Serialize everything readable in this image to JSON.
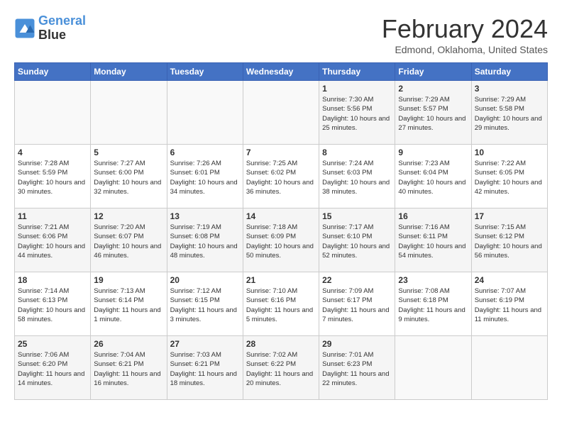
{
  "logo": {
    "line1": "General",
    "line2": "Blue"
  },
  "title": "February 2024",
  "subtitle": "Edmond, Oklahoma, United States",
  "days_of_week": [
    "Sunday",
    "Monday",
    "Tuesday",
    "Wednesday",
    "Thursday",
    "Friday",
    "Saturday"
  ],
  "weeks": [
    [
      {
        "day": "",
        "info": ""
      },
      {
        "day": "",
        "info": ""
      },
      {
        "day": "",
        "info": ""
      },
      {
        "day": "",
        "info": ""
      },
      {
        "day": "1",
        "info": "Sunrise: 7:30 AM\nSunset: 5:56 PM\nDaylight: 10 hours and 25 minutes."
      },
      {
        "day": "2",
        "info": "Sunrise: 7:29 AM\nSunset: 5:57 PM\nDaylight: 10 hours and 27 minutes."
      },
      {
        "day": "3",
        "info": "Sunrise: 7:29 AM\nSunset: 5:58 PM\nDaylight: 10 hours and 29 minutes."
      }
    ],
    [
      {
        "day": "4",
        "info": "Sunrise: 7:28 AM\nSunset: 5:59 PM\nDaylight: 10 hours and 30 minutes."
      },
      {
        "day": "5",
        "info": "Sunrise: 7:27 AM\nSunset: 6:00 PM\nDaylight: 10 hours and 32 minutes."
      },
      {
        "day": "6",
        "info": "Sunrise: 7:26 AM\nSunset: 6:01 PM\nDaylight: 10 hours and 34 minutes."
      },
      {
        "day": "7",
        "info": "Sunrise: 7:25 AM\nSunset: 6:02 PM\nDaylight: 10 hours and 36 minutes."
      },
      {
        "day": "8",
        "info": "Sunrise: 7:24 AM\nSunset: 6:03 PM\nDaylight: 10 hours and 38 minutes."
      },
      {
        "day": "9",
        "info": "Sunrise: 7:23 AM\nSunset: 6:04 PM\nDaylight: 10 hours and 40 minutes."
      },
      {
        "day": "10",
        "info": "Sunrise: 7:22 AM\nSunset: 6:05 PM\nDaylight: 10 hours and 42 minutes."
      }
    ],
    [
      {
        "day": "11",
        "info": "Sunrise: 7:21 AM\nSunset: 6:06 PM\nDaylight: 10 hours and 44 minutes."
      },
      {
        "day": "12",
        "info": "Sunrise: 7:20 AM\nSunset: 6:07 PM\nDaylight: 10 hours and 46 minutes."
      },
      {
        "day": "13",
        "info": "Sunrise: 7:19 AM\nSunset: 6:08 PM\nDaylight: 10 hours and 48 minutes."
      },
      {
        "day": "14",
        "info": "Sunrise: 7:18 AM\nSunset: 6:09 PM\nDaylight: 10 hours and 50 minutes."
      },
      {
        "day": "15",
        "info": "Sunrise: 7:17 AM\nSunset: 6:10 PM\nDaylight: 10 hours and 52 minutes."
      },
      {
        "day": "16",
        "info": "Sunrise: 7:16 AM\nSunset: 6:11 PM\nDaylight: 10 hours and 54 minutes."
      },
      {
        "day": "17",
        "info": "Sunrise: 7:15 AM\nSunset: 6:12 PM\nDaylight: 10 hours and 56 minutes."
      }
    ],
    [
      {
        "day": "18",
        "info": "Sunrise: 7:14 AM\nSunset: 6:13 PM\nDaylight: 10 hours and 58 minutes."
      },
      {
        "day": "19",
        "info": "Sunrise: 7:13 AM\nSunset: 6:14 PM\nDaylight: 11 hours and 1 minute."
      },
      {
        "day": "20",
        "info": "Sunrise: 7:12 AM\nSunset: 6:15 PM\nDaylight: 11 hours and 3 minutes."
      },
      {
        "day": "21",
        "info": "Sunrise: 7:10 AM\nSunset: 6:16 PM\nDaylight: 11 hours and 5 minutes."
      },
      {
        "day": "22",
        "info": "Sunrise: 7:09 AM\nSunset: 6:17 PM\nDaylight: 11 hours and 7 minutes."
      },
      {
        "day": "23",
        "info": "Sunrise: 7:08 AM\nSunset: 6:18 PM\nDaylight: 11 hours and 9 minutes."
      },
      {
        "day": "24",
        "info": "Sunrise: 7:07 AM\nSunset: 6:19 PM\nDaylight: 11 hours and 11 minutes."
      }
    ],
    [
      {
        "day": "25",
        "info": "Sunrise: 7:06 AM\nSunset: 6:20 PM\nDaylight: 11 hours and 14 minutes."
      },
      {
        "day": "26",
        "info": "Sunrise: 7:04 AM\nSunset: 6:21 PM\nDaylight: 11 hours and 16 minutes."
      },
      {
        "day": "27",
        "info": "Sunrise: 7:03 AM\nSunset: 6:21 PM\nDaylight: 11 hours and 18 minutes."
      },
      {
        "day": "28",
        "info": "Sunrise: 7:02 AM\nSunset: 6:22 PM\nDaylight: 11 hours and 20 minutes."
      },
      {
        "day": "29",
        "info": "Sunrise: 7:01 AM\nSunset: 6:23 PM\nDaylight: 11 hours and 22 minutes."
      },
      {
        "day": "",
        "info": ""
      },
      {
        "day": "",
        "info": ""
      }
    ]
  ]
}
